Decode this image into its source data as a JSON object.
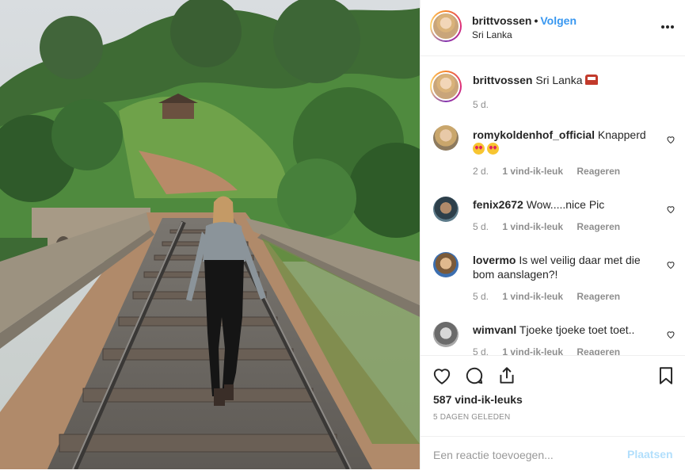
{
  "header": {
    "username": "brittvossen",
    "separator": "•",
    "follow_label": "Volgen",
    "location": "Sri Lanka",
    "more_icon": "more-horizontal-icon"
  },
  "caption": {
    "username": "brittvossen",
    "text": "Sri Lanka",
    "emoji": "train-emoji",
    "age": "5 d."
  },
  "comments": [
    {
      "username": "romykoldenhof_official",
      "text": "Knapperd",
      "emoji": "heart-eyes-emoji",
      "age": "2 d.",
      "likes": "1 vind-ik-leuk",
      "reply": "Reageren"
    },
    {
      "username": "fenix2672",
      "text": "Wow.....nice Pic",
      "age": "5 d.",
      "likes": "1 vind-ik-leuk",
      "reply": "Reageren"
    },
    {
      "username": "lovermo",
      "text": "Is wel veilig daar met die bom aanslagen?!",
      "age": "5 d.",
      "likes": "1 vind-ik-leuk",
      "reply": "Reageren"
    },
    {
      "username": "wimvanl",
      "text": "Tjoeke tjoeke toet toet..",
      "age": "5 d.",
      "likes": "1 vind-ik-leuk",
      "reply": "Reageren"
    }
  ],
  "actions": {
    "icons": [
      "heart-icon",
      "comment-icon",
      "share-icon",
      "bookmark-icon"
    ],
    "like_count": "587 vind-ik-leuks",
    "posted": "5 DAGEN GELEDEN"
  },
  "add_comment": {
    "placeholder": "Een reactie toevoegen...",
    "post_label": "Plaatsen"
  },
  "colors": {
    "link_blue": "#3897f0",
    "post_disabled": "#b2dffc",
    "muted": "#8e8e8e"
  }
}
